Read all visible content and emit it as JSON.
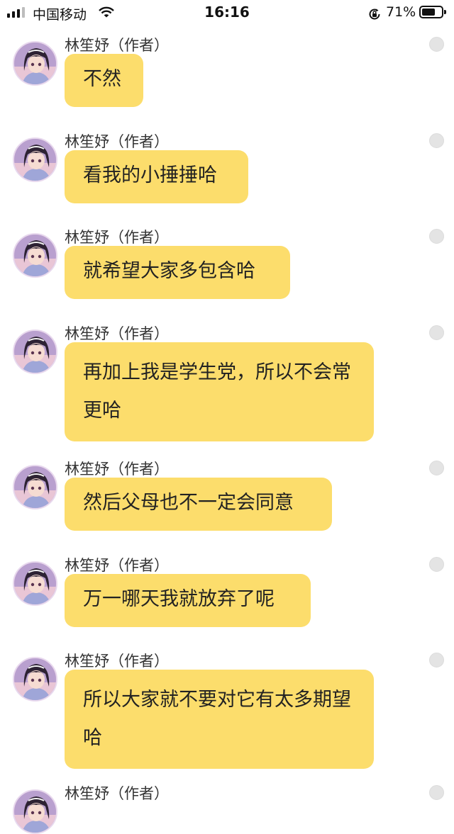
{
  "status_bar": {
    "carrier": "中国移动",
    "time": "16:16",
    "battery_percent": "71%",
    "battery_level": 0.71,
    "signal_bars": 3
  },
  "chat": {
    "messages": [
      {
        "sender": "林笙妤（作者）",
        "text": "不然"
      },
      {
        "sender": "林笙妤（作者）",
        "text": "看我的小捶捶哈"
      },
      {
        "sender": "林笙妤（作者）",
        "text": "就希望大家多包含哈"
      },
      {
        "sender": "林笙妤（作者）",
        "text": "再加上我是学生党，所以不会常更哈"
      },
      {
        "sender": "林笙妤（作者）",
        "text": "然后父母也不一定会同意"
      },
      {
        "sender": "林笙妤（作者）",
        "text": "万一哪天我就放弃了呢"
      },
      {
        "sender": "林笙妤（作者）",
        "text": "所以大家就不要对它有太多期望哈"
      },
      {
        "sender": "林笙妤（作者）",
        "text": ""
      }
    ]
  },
  "colors": {
    "bubble": "#fcdd6c",
    "select_circle": "#e4e4e4"
  },
  "icons": {
    "signal": "signal-bars-icon",
    "wifi": "wifi-icon",
    "orientation_lock": "orientation-lock-icon",
    "battery": "battery-icon",
    "select": "select-circle-icon"
  }
}
